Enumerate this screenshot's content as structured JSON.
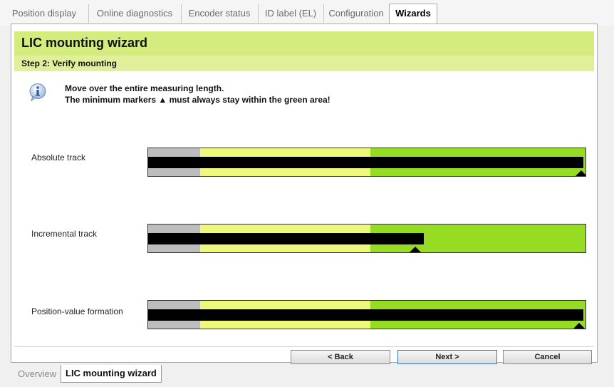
{
  "top_tabs": [
    {
      "label": "Position display"
    },
    {
      "label": "Online diagnostics"
    },
    {
      "label": "Encoder status"
    },
    {
      "label": "ID label (EL)"
    },
    {
      "label": "Configuration"
    },
    {
      "label": "Wizards"
    }
  ],
  "active_top_tab": "Wizards",
  "wizard": {
    "title": "LIC mounting wizard",
    "step": "Step 2: Verify mounting",
    "instruction_line1": "Move over the entire measuring length.",
    "instruction_line2": "The minimum markers ▲ must always stay within the green area!"
  },
  "tracks": [
    {
      "label": "Absolute track",
      "level_fraction": 0.995,
      "marker_fraction": 0.99
    },
    {
      "label": "Incremental track",
      "level_fraction": 0.63,
      "marker_fraction": 0.61
    },
    {
      "label": "Position-value formation",
      "level_fraction": 0.995,
      "marker_fraction": 0.985
    }
  ],
  "zones": {
    "gray_color": "#bdbdbd",
    "yellow_color": "#eef97a",
    "green_color": "#95dc22"
  },
  "buttons": {
    "back": "< Back",
    "next": "Next >",
    "cancel": "Cancel"
  },
  "bottom_tabs": [
    {
      "label": "Overview"
    },
    {
      "label": "LIC mounting wizard"
    }
  ],
  "accent_color": "#d4eb7d"
}
